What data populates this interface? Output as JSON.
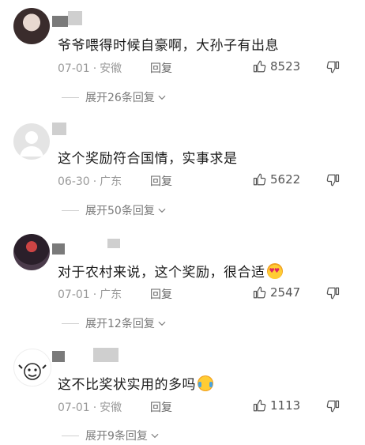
{
  "comments": [
    {
      "text": "爷爷喂得时候自豪啊，大孙子有出息",
      "date": "07-01",
      "location": "安徽",
      "reply_label": "回复",
      "likes": "8523",
      "expand_label": "展开26条回复"
    },
    {
      "text": "这个奖励符合国情，实事求是",
      "date": "06-30",
      "location": "广东",
      "reply_label": "回复",
      "likes": "5622",
      "expand_label": "展开50条回复"
    },
    {
      "text": "对于农村来说，这个奖励，很合适",
      "date": "07-01",
      "location": "广东",
      "reply_label": "回复",
      "likes": "2547",
      "expand_label": "展开12条回复",
      "emoji": "heart-eyes-emoji"
    },
    {
      "text": "这不比奖状实用的多吗",
      "date": "07-01",
      "location": "安徽",
      "reply_label": "回复",
      "likes": "1113",
      "expand_label": "展开9条回复",
      "emoji": "tears-of-joy-emoji"
    }
  ],
  "separator": "·"
}
